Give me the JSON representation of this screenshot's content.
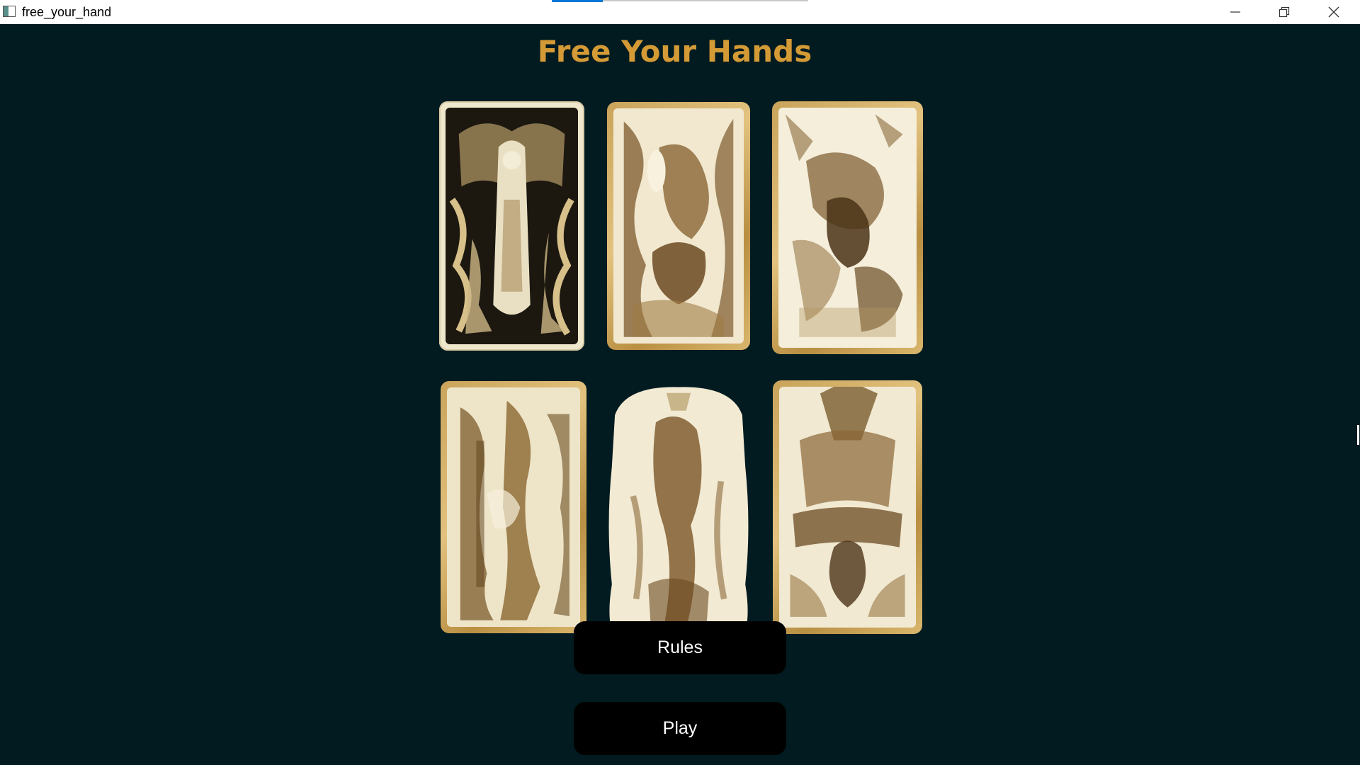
{
  "window": {
    "title": "free_your_hand",
    "controls": {
      "minimize_icon": "minimize-icon",
      "maximize_icon": "restore-icon",
      "close_icon": "close-icon"
    }
  },
  "app": {
    "title": "Free Your Hands",
    "background_color": "#011b20",
    "title_color": "#d49a36"
  },
  "cards": [
    {
      "name": "tarot-card-1",
      "frame": "cream"
    },
    {
      "name": "tarot-card-2",
      "frame": "gold"
    },
    {
      "name": "tarot-card-3",
      "frame": "gold"
    },
    {
      "name": "tarot-card-4",
      "frame": "gold"
    },
    {
      "name": "tarot-card-5",
      "frame": "none"
    },
    {
      "name": "tarot-card-6",
      "frame": "gold"
    }
  ],
  "buttons": {
    "rules_label": "Rules",
    "play_label": "Play",
    "background_color": "#000000",
    "text_color": "#ffffff"
  }
}
